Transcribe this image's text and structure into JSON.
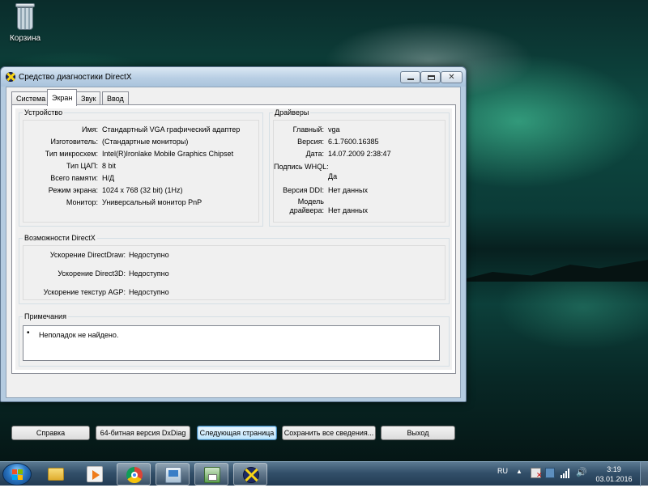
{
  "desktop": {
    "recycle_bin_label": "Корзина"
  },
  "window": {
    "title": "Средство диагностики DirectX",
    "tabs": [
      {
        "label": "Система",
        "active": false
      },
      {
        "label": "Экран",
        "active": true
      },
      {
        "label": "Звук",
        "active": false
      },
      {
        "label": "Ввод",
        "active": false
      }
    ],
    "device": {
      "group_label": "Устройство",
      "rows": [
        {
          "label": "Имя:",
          "value": "Стандартный VGA графический адаптер"
        },
        {
          "label": "Изготовитель:",
          "value": "(Стандартные мониторы)"
        },
        {
          "label": "Тип микросхем:",
          "value": "Intel(R)Ironlake Mobile Graphics Chipset"
        },
        {
          "label": "Тип ЦАП:",
          "value": "8 bit"
        },
        {
          "label": "Всего памяти:",
          "value": "Н/Д"
        },
        {
          "label": "Режим экрана:",
          "value": "1024 x 768 (32 bit) (1Hz)"
        },
        {
          "label": "Монитор:",
          "value": "Универсальный монитор PnP"
        }
      ]
    },
    "drivers": {
      "group_label": "Драйверы",
      "rows": [
        {
          "label": "Главный:",
          "value": "vga"
        },
        {
          "label": "Версия:",
          "value": "6.1.7600.16385"
        },
        {
          "label": "Дата:",
          "value": "14.07.2009 2:38:47"
        },
        {
          "label": "Подпись WHQL:",
          "value": "Да"
        },
        {
          "label": "Версия DDI:",
          "value": "Нет данных"
        },
        {
          "label": "Модель",
          "label2": "драйвера:",
          "value": "Нет данных"
        }
      ]
    },
    "features": {
      "group_label": "Возможности DirectX",
      "rows": [
        {
          "label": "Ускорение DirectDraw:",
          "value": "Недоступно"
        },
        {
          "label": "Ускорение Direct3D:",
          "value": "Недоступно"
        },
        {
          "label": "Ускорение текстур AGP:",
          "value": "Недоступно"
        }
      ]
    },
    "notes": {
      "group_label": "Примечания",
      "items": [
        "Неполадок не найдено."
      ]
    },
    "buttons": {
      "help": "Справка",
      "dxdiag64": "64-битная версия DxDiag",
      "next_page": "Следующая страница",
      "save_all": "Сохранить все сведения...",
      "exit": "Выход"
    }
  },
  "taskbar": {
    "apps": [
      {
        "icon": "explorer-folder-icon",
        "active": false
      },
      {
        "icon": "media-player-icon",
        "active": false
      },
      {
        "icon": "chrome-icon",
        "active": true
      },
      {
        "icon": "control-panel-icon",
        "active": true
      },
      {
        "icon": "installer-icon",
        "active": true
      },
      {
        "icon": "directx-icon",
        "active": true
      }
    ],
    "tray": {
      "language": "RU",
      "time": "3:19",
      "date": "03.01.2016"
    }
  },
  "colors": {
    "accent": "#3c7fb1",
    "window_frame": "#b4cbe0",
    "taskbar": "#33506a"
  }
}
